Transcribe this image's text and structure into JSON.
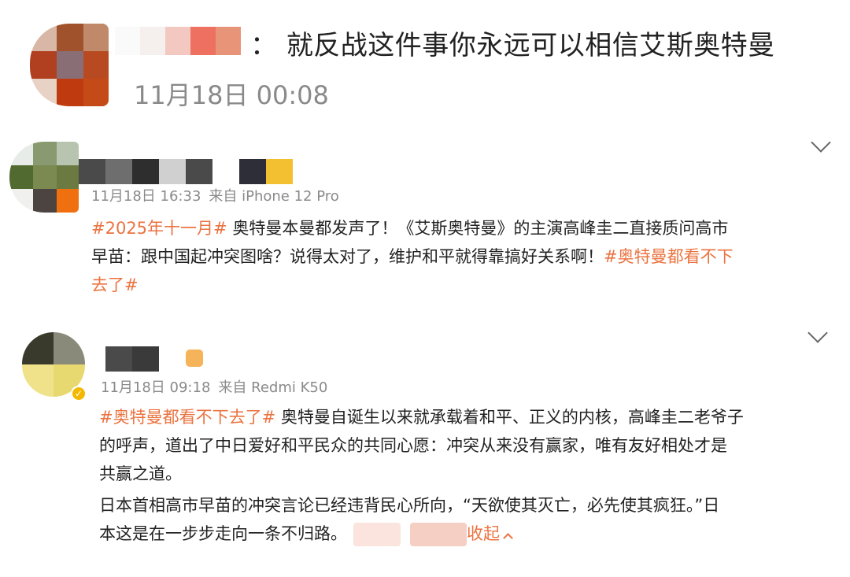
{
  "header": {
    "separator": "：",
    "text": "就反战这件事你永远可以相信艾斯奥特曼",
    "time": "11月18日 00:08"
  },
  "comments": [
    {
      "meta": {
        "date": "11月18日 16:33",
        "source": "来自 iPhone 12 Pro"
      },
      "lines": [
        [
          {
            "t": "#2025年十一月#",
            "tag": true
          },
          {
            "t": " 奥特曼本曼都发声了！《艾斯奥特曼》的主演高峰圭二直接质问高市",
            "tag": false
          }
        ],
        [
          {
            "t": "早苗：跟中国起冲突图啥？说得太对了，维护和平就得靠搞好关系啊！",
            "tag": false
          },
          {
            "t": "#奥特曼都看不下",
            "tag": true
          }
        ],
        [
          {
            "t": "去了#",
            "tag": true
          }
        ]
      ]
    },
    {
      "meta": {
        "date": "11月18日 09:18",
        "source": "来自 Redmi K50"
      },
      "lines": [
        [
          {
            "t": "#奥特曼都看不下去了#",
            "tag": true
          },
          {
            "t": " 奥特曼自诞生以来就承载着和平、正义的内核，高峰圭二老爷子",
            "tag": false
          }
        ],
        [
          {
            "t": "的呼声，道出了中日爱好和平民众的共同心愿：冲突从来没有赢家，唯有友好相处才是",
            "tag": false
          }
        ],
        [
          {
            "t": "共赢之道。",
            "tag": false
          }
        ],
        [
          {
            "t": "日本首相高市早苗的冲突言论已经违背民心所向，“天欲使其灭亡，必先使其疯狂。”日",
            "tag": false
          }
        ],
        [
          {
            "t": "本这是在一步步走向一条不归路。",
            "tag": false
          }
        ]
      ],
      "collapse_label": "收起"
    }
  ],
  "icons": {
    "expand": "chevron-down-icon",
    "collapse": "chevron-up-icon",
    "verified": "verified-badge-icon"
  },
  "colors": {
    "tag": "#eb7340",
    "text": "#222222",
    "meta": "#8a8a8a",
    "verified": "#f5b800"
  }
}
